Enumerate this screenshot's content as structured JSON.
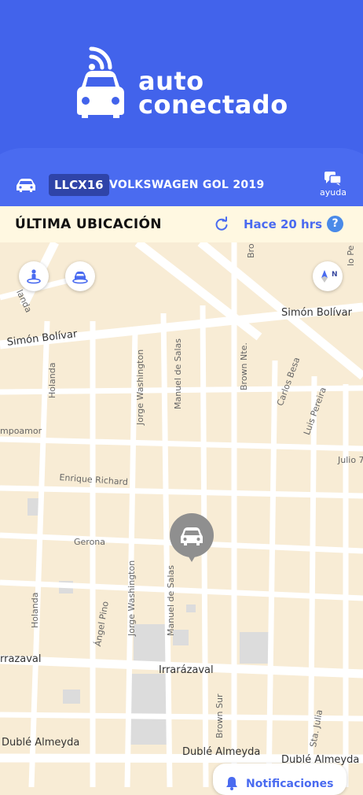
{
  "logo": {
    "line1": "auto",
    "line2": "conectado"
  },
  "vehicle": {
    "plate": "LLCX16",
    "model": "VOLKSWAGEN GOL 2019",
    "help_label": "ayuda"
  },
  "status": {
    "title": "ÚLTIMA UBICACIÓN",
    "time_ago": "Hace 20 hrs",
    "help_symbol": "?"
  },
  "compass": {
    "label": "N"
  },
  "map": {
    "streets": {
      "simon_bolivar_left": "Simón Bolívar",
      "simon_bolivar_right": "Simón Bolívar",
      "holanda_top": "Holanda",
      "holanda_mid": "Holanda",
      "holanda_bottom": "Holanda",
      "jorge_washington_top": "Jorge Washington",
      "jorge_washington_bottom": "Jorge Washington",
      "manuel_de_salas_top": "Manuel de Salas",
      "manuel_de_salas_bottom": "Manuel de Salas",
      "brown_nte": "Brown Nte.",
      "brown_sur": "Brown Sur",
      "bro": "Bro",
      "carlos_besa": "Carlos Besa",
      "luis_pereira": "Luis Pereira",
      "campoamor": "mpoamor",
      "julio": "Julio 7",
      "enrique_richard": "Enrique Richard",
      "gerona": "Gerona",
      "angel_pino": "Ángel Pino",
      "irrarazaval_left": "rrazaval",
      "irrarazaval_mid": "Irrarázaval",
      "duble_almeyda_left": "Dublé Almeyda",
      "duble_almeyda_mid": "Dublé Almeyda",
      "duble_almeyda_right": "Dublé Almeyda",
      "sta_julia": "Sta. Julia",
      "corner_top_left": "landa",
      "corner_top_right": "lo Pe"
    }
  },
  "notifications": {
    "label": "Notificaciones"
  },
  "colors": {
    "primary": "#4263eb",
    "accent": "#4a6bf0",
    "map_land": "#f8ecd5",
    "map_road": "#ffffff"
  }
}
